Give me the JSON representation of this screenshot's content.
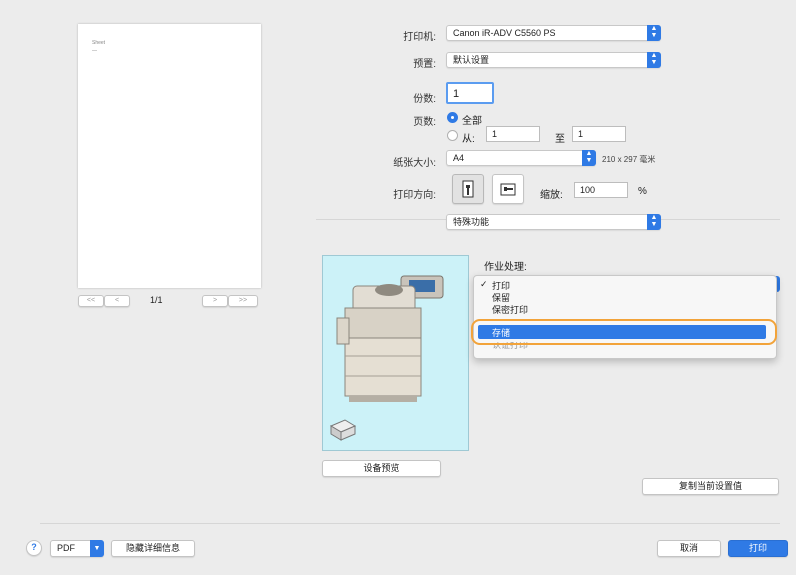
{
  "preview": {
    "page_text_line1": "Sheet",
    "page_text_line2": "—",
    "first_label": "<<",
    "prev_label": "<",
    "page_counter": "1/1",
    "next_label": ">",
    "last_label": ">>"
  },
  "printer": {
    "label": "打印机:",
    "value": "Canon iR-ADV C5560 PS"
  },
  "presets": {
    "label": "预置:",
    "value": "默认设置"
  },
  "copies": {
    "label": "份数:",
    "value": "1"
  },
  "pages": {
    "label": "页数:",
    "all_label": "全部",
    "from_label": "从:",
    "from_value": "1",
    "to_label": "至",
    "to_value": "1"
  },
  "paper_size": {
    "label": "纸张大小:",
    "value": "A4",
    "dimensions": "210 x 297 毫米"
  },
  "orientation": {
    "label": "打印方向:",
    "scale_label": "缩放:",
    "scale_value": "100",
    "scale_unit": "%"
  },
  "section_popup": {
    "value": "特殊功能"
  },
  "job_handling": {
    "label": "作业处理:",
    "menu_items": [
      {
        "label": "打印",
        "checked": true,
        "selected": false
      },
      {
        "label": "保留",
        "checked": false,
        "selected": false
      },
      {
        "label": "保密打印",
        "checked": false,
        "selected": false
      },
      {
        "label": "存储",
        "checked": false,
        "selected": true
      },
      {
        "label": "认证打印",
        "checked": false,
        "selected": false
      }
    ],
    "checkmark": "✓",
    "highlight_color": "#f2a33a"
  },
  "device_preview_label": "设备预览",
  "copy_settings_label": "复制当前设置值",
  "bottom": {
    "help": "?",
    "pdf": "PDF",
    "hide_details": "隐藏详细信息",
    "cancel": "取消",
    "print": "打印"
  },
  "colors": {
    "accent": "#2f7ae5",
    "preview_bg": "#ccf2f8"
  }
}
